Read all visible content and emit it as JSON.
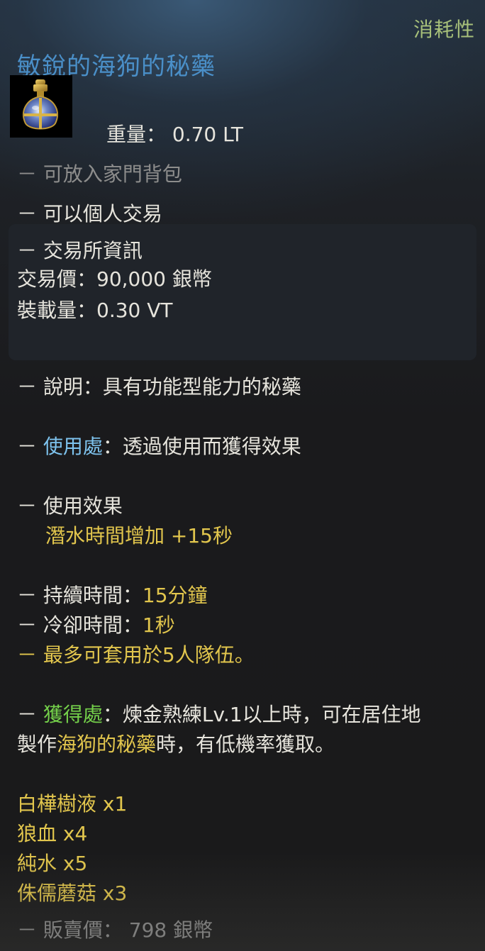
{
  "category": "消耗性",
  "item_name": "敏銳的海狗的秘藥",
  "icon": "potion-flask-icon",
  "weight": "重量： 0.70 LT",
  "family_bag": "－ 可放入家門背包",
  "personal_trade": "－ 可以個人交易",
  "market": {
    "header": "－ 交易所資訊",
    "price": "交易價：90,000 銀幣",
    "load": "裝載量：0.30 VT"
  },
  "description": "－ 說明：具有功能型能力的秘藥",
  "usage": {
    "prefix": "－ ",
    "label": "使用處",
    "text": "：透過使用而獲得效果"
  },
  "effect": {
    "header": "－ 使用效果",
    "value": "潛水時間增加 +15秒"
  },
  "duration": {
    "prefix": "－ 持續時間：",
    "value": "15分鐘"
  },
  "cooldown": {
    "prefix": "－ 冷卻時間：",
    "value": "1秒"
  },
  "party": "－ 最多可套用於5人隊伍。",
  "obtain": {
    "prefix": "－ ",
    "label": "獲得處",
    "text1": "：煉金熟練Lv.1以上時，可在居住地",
    "text2_a": "製作",
    "text2_b": "海狗的秘藥",
    "text2_c": "時，有低機率獲取。"
  },
  "ingredients": [
    {
      "name": "白樺樹液",
      "qty": "x1"
    },
    {
      "name": "狼血",
      "qty": "x4"
    },
    {
      "name": "純水",
      "qty": "x5"
    },
    {
      "name": "侏儒蘑菇",
      "qty": "x3"
    }
  ],
  "sell_price": "－ 販賣價： 798 銀幣",
  "colors": {
    "name": "#4a8fc8",
    "category": "#a7c07a",
    "usage_label": "#7ec3ee",
    "obtain_label": "#74d04a",
    "highlight": "#e2c64d",
    "muted": "#8d8d8c"
  }
}
